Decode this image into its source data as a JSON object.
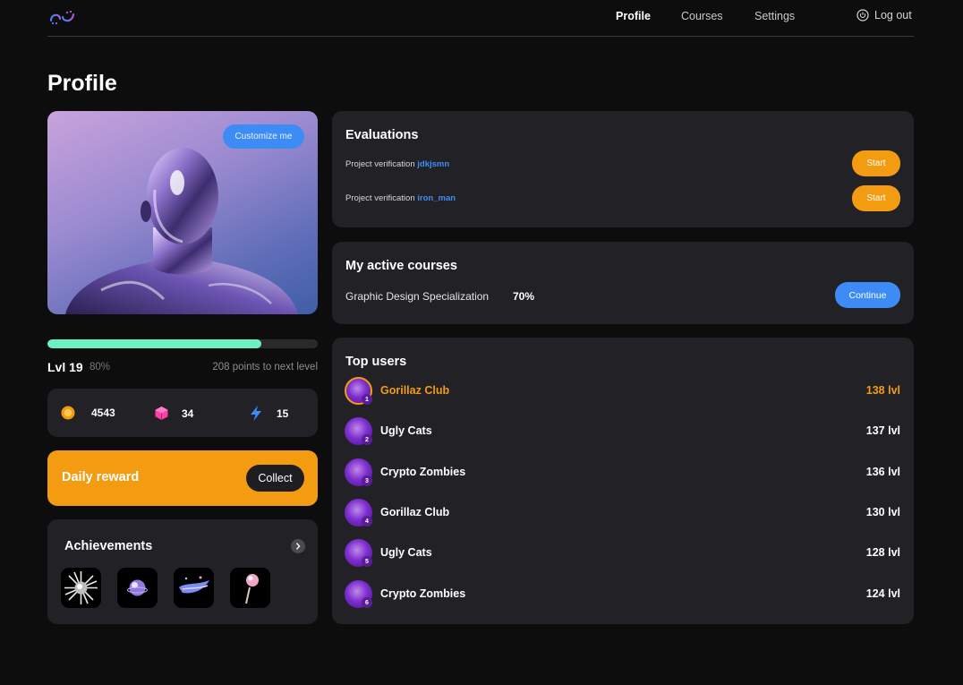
{
  "nav": {
    "logo_icon": "app-logo-icon",
    "links": [
      "Profile",
      "Courses",
      "Settings"
    ],
    "active": "Profile",
    "logout_label": "Log out"
  },
  "page": {
    "title": "Profile"
  },
  "avatar": {
    "customize_label": "Customize me"
  },
  "progress": {
    "fraction": 0.79,
    "level_label": "Lvl 19",
    "percent_label": "80%",
    "next_level_label": "208 points to next level"
  },
  "stats": [
    {
      "icon": "coin-icon",
      "value": "4543"
    },
    {
      "icon": "cube-icon",
      "value": "34"
    },
    {
      "icon": "lightning-icon",
      "value": "15"
    }
  ],
  "daily": {
    "title": "Daily reward",
    "collect_label": "Collect"
  },
  "achievements": {
    "title": "Achievements",
    "items": [
      "spiky-star-achievement",
      "bubble-achievement",
      "wing-achievement",
      "lollipop-achievement"
    ]
  },
  "evaluations": {
    "title": "Evaluations",
    "rows": [
      {
        "text": "Project verification",
        "user": "jdkjsmn",
        "button": "Start"
      },
      {
        "text": "Project verification",
        "user": "iron_man",
        "button": "Start"
      }
    ]
  },
  "courses": {
    "title": "My active courses",
    "items": [
      {
        "name": "Graphic Design Specialization",
        "percent": "70%",
        "button": "Continue"
      }
    ]
  },
  "top_users": {
    "title": "Top users",
    "rows": [
      {
        "rank": "1",
        "name": "Gorillaz Club",
        "level": "138 lvl",
        "highlight": true
      },
      {
        "rank": "2",
        "name": "Ugly Cats",
        "level": "137 lvl"
      },
      {
        "rank": "3",
        "name": "Crypto Zombies",
        "level": "136 lvl"
      },
      {
        "rank": "4",
        "name": "Gorillaz Club",
        "level": "130 lvl"
      },
      {
        "rank": "5",
        "name": "Ugly Cats",
        "level": "128 lvl"
      },
      {
        "rank": "6",
        "name": "Crypto Zombies",
        "level": "124 lvl"
      }
    ]
  },
  "colors": {
    "background": "#0d0d0e",
    "card": "#222226",
    "accent_blue": "#3d8cf5",
    "accent_orange": "#f39c12",
    "progress": "#6ef0c6"
  }
}
